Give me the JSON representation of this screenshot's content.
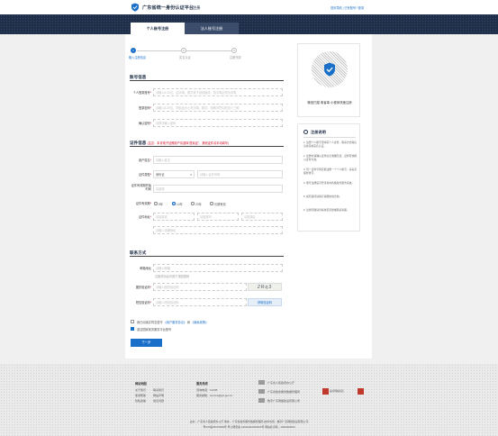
{
  "header": {
    "title": "广东省统一身份认证平台",
    "subtitle": "注册",
    "links": "首页导航 | 已有账号? 登录"
  },
  "tabs": [
    {
      "label": "个人账号注册",
      "active": true
    },
    {
      "label": "法人账号注册",
      "active": false
    }
  ],
  "steps": [
    {
      "num": "1",
      "label": "输入注册信息",
      "active": true
    },
    {
      "num": "2",
      "label": "实名认证",
      "active": false
    },
    {
      "num": "3",
      "label": "注册完成",
      "active": false
    }
  ],
  "account_section": {
    "title": "账号信息",
    "fields": [
      {
        "label": "个人登录账号",
        "placeholder": "请输入6-20位，由字母、数字或下划线组成，首字母必须为字母"
      },
      {
        "label": "登录密码",
        "placeholder": "请输入8-20位，须包含大小写字母、数字、特殊字符中的至少三种"
      },
      {
        "label": "确认密码",
        "placeholder": "请再次输入密码"
      }
    ]
  },
  "cert_section": {
    "title": "证件信息",
    "note": "(注意：本省电子证照用户请选择“居民证”，其他证件请手动填写)",
    "name_label": "用户姓名",
    "name_placeholder": "请输入姓名",
    "type_label": "证件类型",
    "type_value": "身份证",
    "number_placeholder": "请输入证件号码",
    "start_label": "证件有效期开始时间",
    "start_placeholder": "请选择",
    "period_label": "证件有效期",
    "period_options": [
      {
        "label": "5年",
        "selected": false
      },
      {
        "label": "10年",
        "selected": true
      },
      {
        "label": "20年",
        "selected": false
      },
      {
        "label": "长期有效",
        "selected": false
      }
    ],
    "address_label": "证件地址",
    "address_selects": [
      "请选择省",
      "请选择市",
      "请选择区"
    ],
    "address_placeholder": "请输入详细地址"
  },
  "contact_section": {
    "title": "联系方式",
    "email_label": "邮箱地址",
    "email_placeholder": "请输入邮箱",
    "email_hint": "注册成功后可用于找回密码",
    "captcha_label": "图形验证码",
    "captcha_placeholder": "请输入图形验证码",
    "captcha_text": "2Rq3",
    "sms_label": "短信验证码",
    "sms_placeholder": "请输入短信验证码",
    "sms_button": "获取验证码"
  },
  "agreements": [
    {
      "text": "我已阅读并同意遵守",
      "link1": "《用户服务协议》",
      "and": "和",
      "link2": "《隐私政策》",
      "checked": false
    },
    {
      "text": "激活国家政务服务平台账号",
      "checked": true
    }
  ],
  "next_button": "下一步",
  "qr_panel": {
    "caption": "微信扫描 粤省事 小程序快速注册"
  },
  "help_panel": {
    "title": "注册说明",
    "items": [
      "1. 注册个人账号须填写个人身份、联系方式等信息并完成实名认证。",
      "2. 注册时请确认证件信息准确无误，证件有效期以证件为准。",
      "3. 同一证件号码仅能注册一个个人账号，请妥善保管账号。",
      "4. 账号注册后可登录省内各级政务服务系统。",
      "5. 如有疑问请拨打客服热线咨询。",
      "6. 注册问题请查看常见问题或联系客服。"
    ]
  },
  "footer": {
    "col1_title": "网站地图",
    "col1_links": [
      "关于我们",
      "联系我们",
      "使用帮助",
      "网站声明",
      "隐私政策",
      "常见问题"
    ],
    "col2_title": "服务热线",
    "col2_lines": [
      "咨询电话：12345",
      "服务邮箱：service@gd.gov.cn"
    ],
    "col3_lines": [
      "广东省人民政府办公厅",
      "广东省政务服务数据管理局",
      "数字广东网络建设有限公司"
    ],
    "badge1": "政府网站找错",
    "copyright": "主办：广东省人民政府办公厅  承办：广东省政务服务数据管理局  技术支持：数字广东网络建设有限公司",
    "icp": "粤ICP备05070829号  粤公网安备 44010402000000号  网站标识码：4400000000"
  },
  "colors": {
    "primary": "#1a6fc9",
    "navy": "#1f2e46",
    "required": "#d0021b"
  }
}
